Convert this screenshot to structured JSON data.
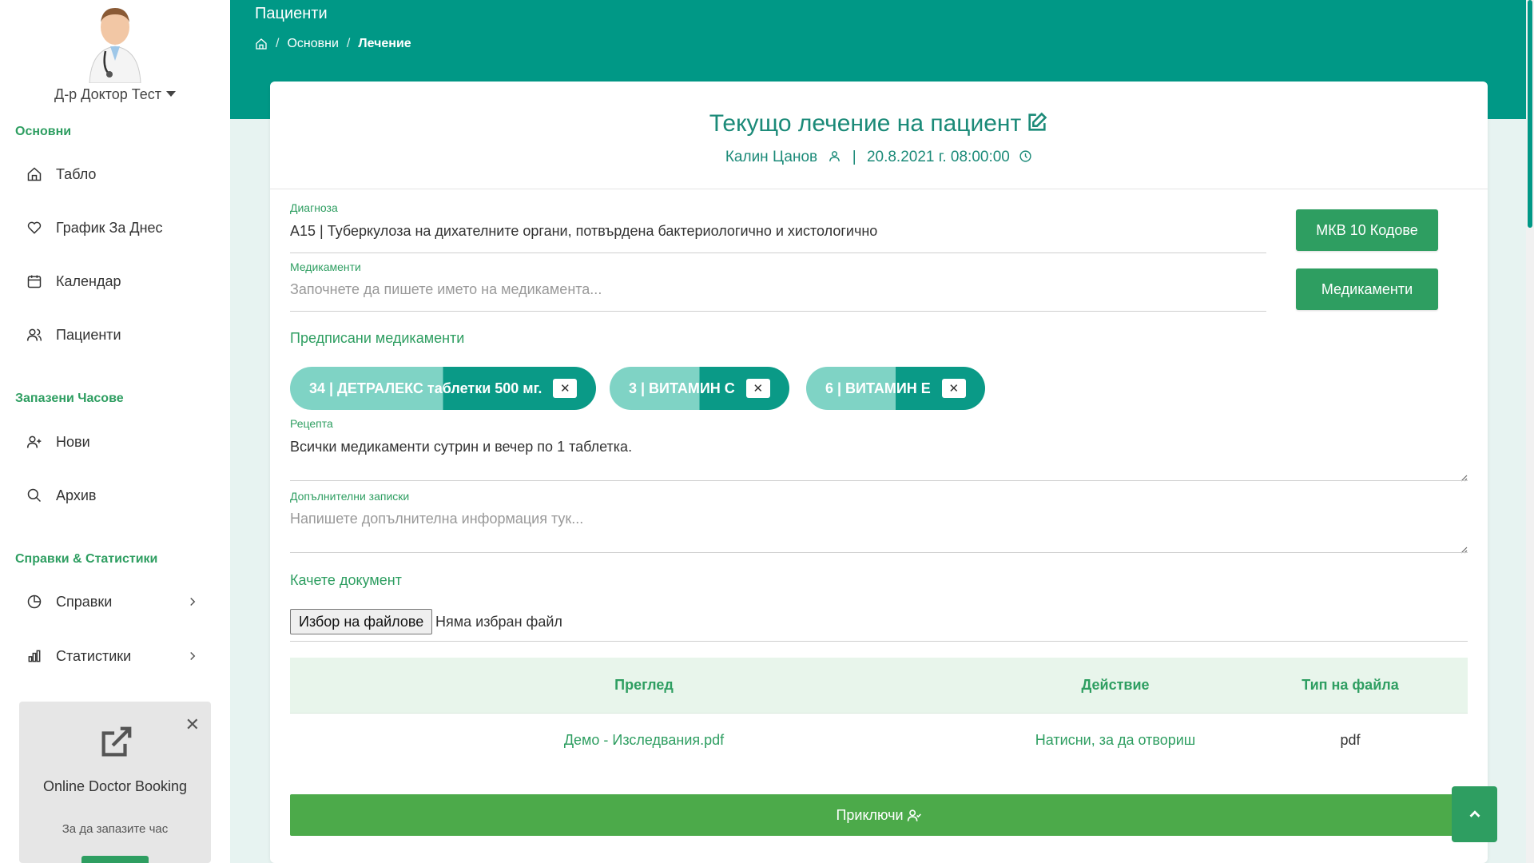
{
  "user": {
    "name": "Д-р Доктор Тест"
  },
  "sidebar": {
    "sections": [
      {
        "title": "Основни"
      },
      {
        "title": "Запазени Часове"
      },
      {
        "title": "Справки & Статистики"
      }
    ],
    "items": [
      {
        "label": "Табло",
        "icon": "home-icon"
      },
      {
        "label": "График За Днес",
        "icon": "heart-icon"
      },
      {
        "label": "Календар",
        "icon": "calendar-icon"
      },
      {
        "label": "Пациенти",
        "icon": "users-icon"
      },
      {
        "label": "Нови",
        "icon": "user-plus-icon"
      },
      {
        "label": "Архив",
        "icon": "search-icon"
      },
      {
        "label": "Справки",
        "icon": "pie-chart-icon"
      },
      {
        "label": "Статистики",
        "icon": "bar-chart-icon"
      }
    ],
    "promo": {
      "title": "Online Doctor Booking",
      "subtitle": "За да запазите час",
      "close": "✕"
    }
  },
  "header": {
    "title": "Пациенти",
    "breadcrumb": {
      "section": "Основни",
      "current": "Лечение",
      "separator": "/"
    }
  },
  "card": {
    "title": "Текущо лечение на пациент",
    "patient": "Калин Цанов",
    "separator": "|",
    "datetime": "20.8.2021 г. 08:00:00"
  },
  "form": {
    "diagnosis": {
      "label": "Диагноза",
      "value": "A15 | Туберкулоза на дихателните органи,  потвърдена бактериологично  и хистологично"
    },
    "medications": {
      "label": "Медикаменти",
      "placeholder": "Започнете да пишете името на медикамента..."
    },
    "buttons": {
      "icd": "МКВ 10 Кодове",
      "meds": "Медикаменти"
    },
    "prescribed_title": "Предписани медикаменти",
    "chips": [
      {
        "label": "34 | ДЕТРАЛЕКС таблетки 500 мг."
      },
      {
        "label": "3 | ВИТАМИН С"
      },
      {
        "label": "6 | ВИТАМИН Е"
      }
    ],
    "chip_remove": "✕",
    "recipe": {
      "label": "Рецепта",
      "value": "Всички медикаменти сутрин и вечер по 1 таблетка."
    },
    "notes": {
      "label": "Допълнителни записки",
      "placeholder": "Напишете допълнителна информация тук..."
    },
    "upload": {
      "title": "Качете документ",
      "button": "Избор на файлове",
      "status": "Няма избран файл"
    }
  },
  "table": {
    "headers": [
      "Преглед",
      "Действие",
      "Тип на файла"
    ],
    "rows": [
      {
        "file": "Демо - Изследвания.pdf",
        "action": "Натисни, за да отвориш",
        "type": "pdf"
      }
    ]
  },
  "finish": {
    "label": "Приключи"
  },
  "colors": {
    "primary": "#009886",
    "green": "#2e9e61",
    "finish": "#4caa4a",
    "background": "#e7f3f1"
  }
}
